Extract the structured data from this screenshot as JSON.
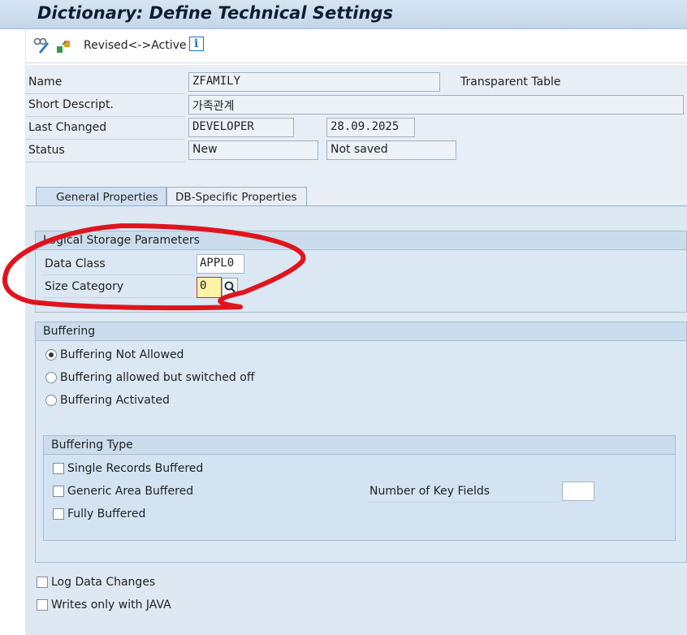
{
  "window": {
    "title": "Dictionary: Define Technical Settings"
  },
  "toolbar": {
    "toggle_label": "Revised<->Active"
  },
  "header": {
    "name_label": "Name",
    "name_value": "ZFAMILY",
    "table_type": "Transparent Table",
    "short_desc_label": "Short Descript.",
    "short_desc_value": "가족관계",
    "last_changed_label": "Last Changed",
    "last_changed_user": "DEVELOPER",
    "last_changed_date": "28.09.2025",
    "status_label": "Status",
    "status_value": "New",
    "save_status": "Not saved"
  },
  "tabs": [
    {
      "label": "General Properties",
      "active": true
    },
    {
      "label": "DB-Specific Properties",
      "active": false
    }
  ],
  "logical_storage": {
    "title": "Logical Storage Parameters",
    "data_class_label": "Data Class",
    "data_class_value": "APPL0",
    "size_category_label": "Size Category",
    "size_category_value": "0"
  },
  "buffering": {
    "title": "Buffering",
    "options": [
      {
        "label": "Buffering Not Allowed",
        "selected": true
      },
      {
        "label": "Buffering allowed but switched off",
        "selected": false
      },
      {
        "label": "Buffering Activated",
        "selected": false
      }
    ],
    "type": {
      "title": "Buffering Type",
      "single": "Single Records Buffered",
      "generic": "Generic Area Buffered",
      "full": "Fully Buffered",
      "key_fields_label": "Number of Key Fields",
      "key_fields_value": ""
    }
  },
  "options": {
    "log_changes": "Log Data Changes",
    "writes_java": "Writes only with JAVA"
  },
  "colors": {
    "annotation": "#e0141e",
    "accent": "#1a73c9"
  }
}
